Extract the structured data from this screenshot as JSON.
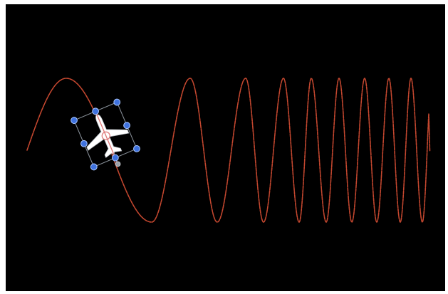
{
  "canvas": {
    "background": "#000000"
  },
  "motion_path": {
    "color": "#c4472f"
  },
  "layer": {
    "icon": "airplane-icon",
    "handle_color": "#3f72de",
    "bounding_box_color": "#8b939c",
    "airplane_fill": "#ffffff",
    "anchor_line_color": "#e07c7c"
  }
}
